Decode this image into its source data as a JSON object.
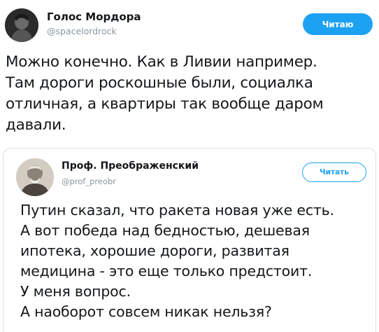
{
  "outer_tweet": {
    "author_name": "Голос Мордора",
    "author_handle": "@spacelordrock",
    "follow_label": "Читаю",
    "text_lines": [
      "Можно конечно. Как в Ливии например.",
      "Там дороги роскошные были, социалка",
      "отличная, а квартиры так вообще даром",
      "давали."
    ]
  },
  "quoted_tweet": {
    "author_name": "Проф. Преображенский",
    "author_handle": "@prof_preobr",
    "follow_label": "Читать",
    "text_lines": [
      "Путин сказал, что ракета новая уже есть.",
      "А вот победа над бедностью, дешевая",
      "ипотека, хорошие дороги, развитая",
      "медицина - это еще только предстоит.",
      "У меня вопрос.",
      "А наоборот совсем никак нельзя?"
    ]
  },
  "colors": {
    "accent": "#1da1f2",
    "text": "#14171a",
    "secondary_text": "#8a96a0",
    "border": "#d8dfe5"
  }
}
